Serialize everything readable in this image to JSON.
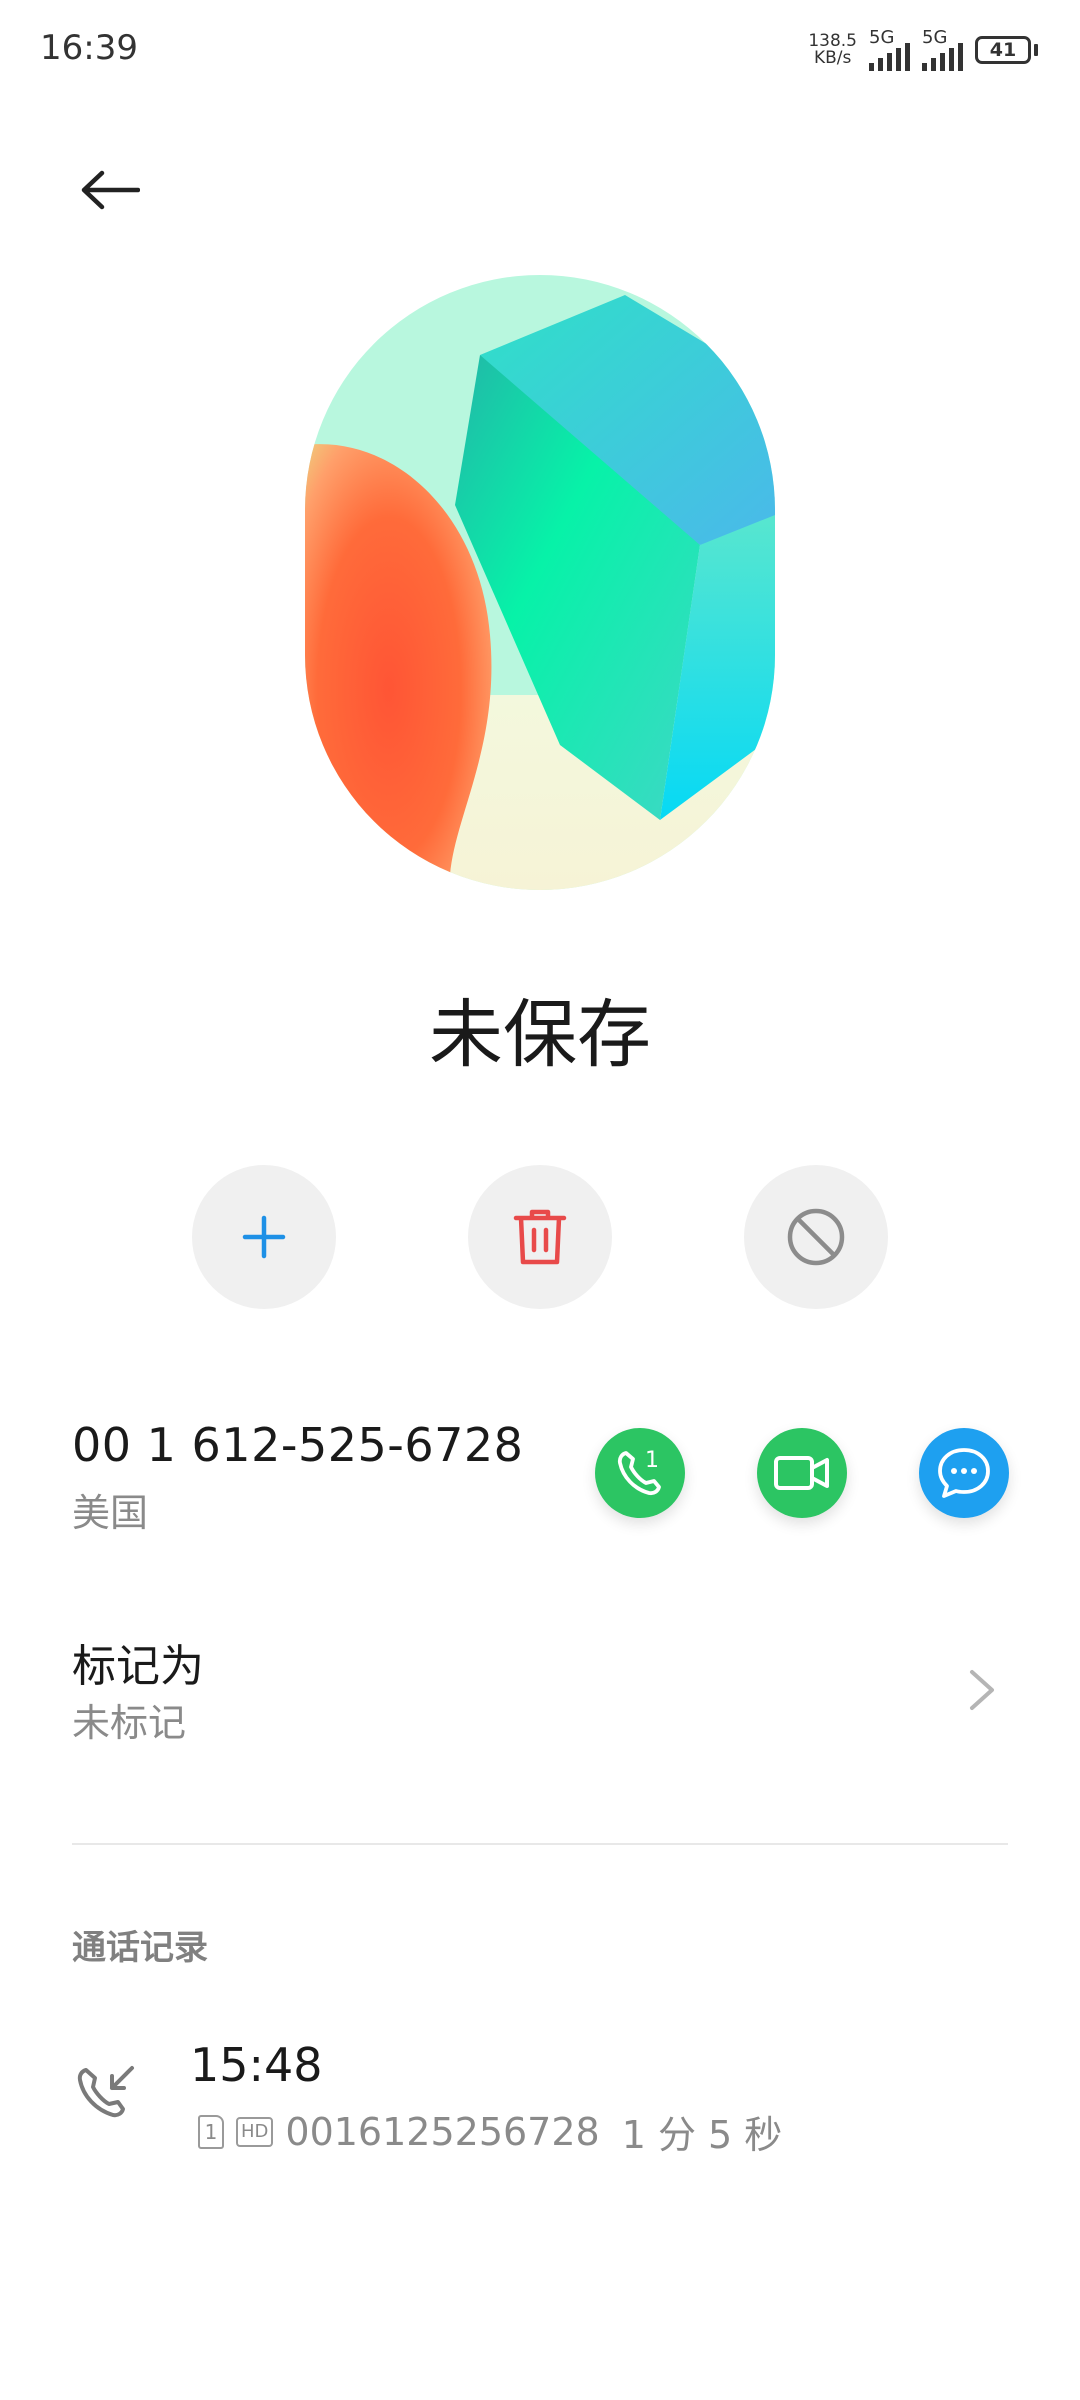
{
  "status_bar": {
    "time": "16:39",
    "net_speed": "138.5",
    "net_unit": "KB/s",
    "sim1_label": "5G",
    "sim2_label": "5G",
    "battery": "41"
  },
  "header": {
    "back_icon": "arrow-left-icon"
  },
  "contact": {
    "name": "未保存"
  },
  "actions": [
    {
      "icon": "plus-icon",
      "color": "#1e90e6"
    },
    {
      "icon": "trash-icon",
      "color": "#e84a4a"
    },
    {
      "icon": "block-icon",
      "color": "#8c8c8c"
    }
  ],
  "phone": {
    "number": "00 1 612-525-6728",
    "region": "美国",
    "call_sim1_badge": "1",
    "buttons": [
      {
        "icon": "phone-sim1-icon",
        "color": "#2cc563"
      },
      {
        "icon": "video-call-icon",
        "color": "#2cc563"
      },
      {
        "icon": "message-icon",
        "color": "#1ea0f0"
      }
    ]
  },
  "mark": {
    "title": "标记为",
    "value": "未标记"
  },
  "call_log": {
    "section_label": "通话记录",
    "entries": [
      {
        "time": "15:48",
        "sim": "1",
        "hd": "HD",
        "number": "0016125256728",
        "duration": "1 分 5 秒",
        "icon": "incoming-call-icon"
      }
    ]
  }
}
